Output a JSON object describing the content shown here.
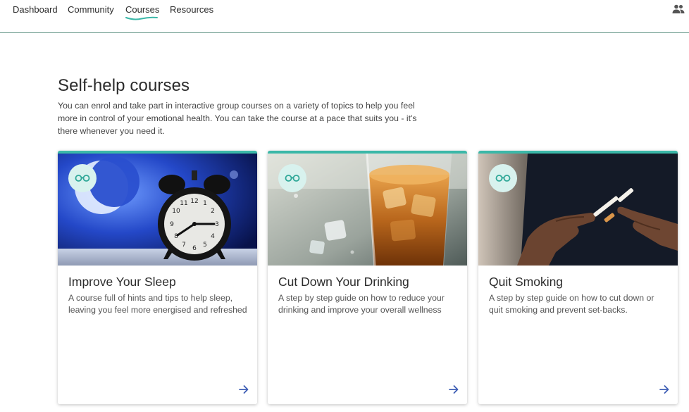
{
  "nav": {
    "items": [
      {
        "label": "Dashboard"
      },
      {
        "label": "Community"
      },
      {
        "label": "Courses",
        "active": true
      },
      {
        "label": "Resources"
      }
    ],
    "profile_icon": "people-icon"
  },
  "page": {
    "title": "Self-help courses",
    "intro": "You can enrol and take part in interactive group courses on a variety of topics to help you feel more in control of your emotional health. You can take the course at a pace that suits you - it's there whenever you need it."
  },
  "courses": [
    {
      "title": "Improve Your Sleep",
      "description": "A course full of hints and tips to help sleep, leaving you feel more energised and refreshed",
      "badge_icon": "glasses-icon",
      "arrow_icon": "arrow-right-icon"
    },
    {
      "title": "Cut Down Your Drinking",
      "description": "A step by step guide on how to reduce your drinking and improve your overall wellness",
      "badge_icon": "glasses-icon",
      "arrow_icon": "arrow-right-icon"
    },
    {
      "title": "Quit Smoking",
      "description": "A step by step guide on how to cut down or quit smoking and prevent set-backs.",
      "badge_icon": "glasses-icon",
      "arrow_icon": "arrow-right-icon"
    }
  ],
  "colors": {
    "accent": "#3bb8a8",
    "badge_bg": "#d8f2ee",
    "arrow": "#3f5fb5",
    "nav_border": "#6f9d90"
  }
}
